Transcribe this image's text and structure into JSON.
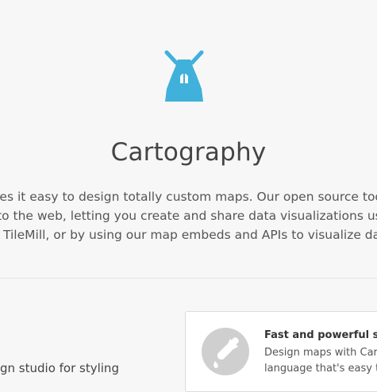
{
  "hero": {
    "title": "Cartography",
    "description_lines": [
      "kes it easy to design totally custom maps. Our open source tools brin",
      "to the web, letting you create and share data visualizations using both",
      "TileMill, or by using our map embeds and APIs to visualize data in yo"
    ],
    "logo_icon": "windmill-icon",
    "accent_color": "#3fb1da"
  },
  "feature": {
    "left_text": "gn studio for styling",
    "card": {
      "icon": "eyedropper-icon",
      "title": "Fast and powerful styling",
      "lines": [
        "Design maps with CartoC",
        "language that's easy to le"
      ]
    }
  }
}
